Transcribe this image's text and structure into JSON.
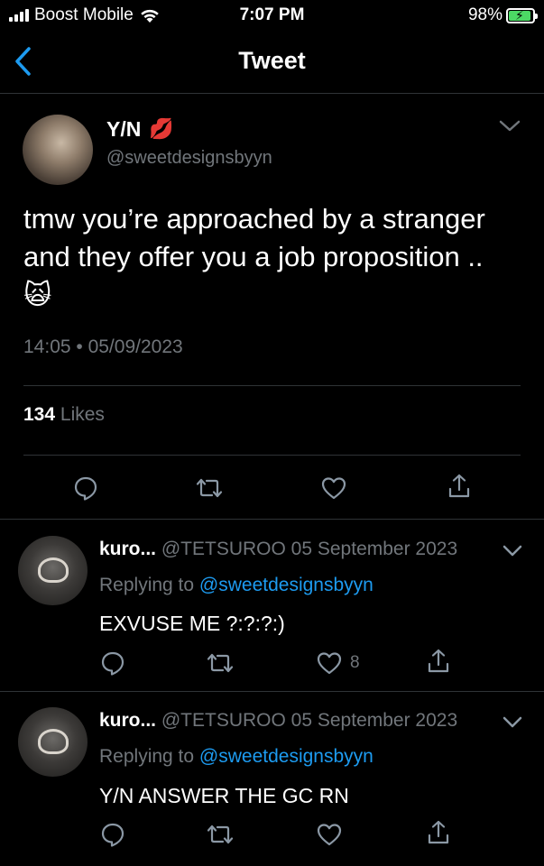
{
  "status_bar": {
    "carrier": "Boost Mobile",
    "time": "7:07 PM",
    "battery": "98%"
  },
  "nav": {
    "title": "Tweet"
  },
  "tweet": {
    "name": "Y/N",
    "name_emoji": "💋",
    "handle": "@sweetdesignsbyyn",
    "text": "tmw you’re approached by a stranger and they offer you a job proposition ..",
    "text_emoji": "🙀",
    "timestamp": "14:05 • 05/09/2023",
    "likes_count": "134",
    "likes_label": "Likes"
  },
  "replies": [
    {
      "name": "kuro...",
      "meta": "@TETSUROO 05 September 2023",
      "replying_prefix": "Replying to",
      "replying_to": "@sweetdesignsbyyn",
      "text": "EXVUSE ME ?:?:?:)",
      "like_count": "8"
    },
    {
      "name": "kuro...",
      "meta": "@TETSUROO 05 September 2023",
      "replying_prefix": "Replying to",
      "replying_to": "@sweetdesignsbyyn",
      "text": "Y/N ANSWER THE GC RN",
      "like_count": ""
    }
  ],
  "colors": {
    "background": "#000000",
    "secondary_text": "#71767b",
    "link": "#1d9bf0",
    "divider": "#2f3336",
    "battery_fill": "#4cd964"
  }
}
